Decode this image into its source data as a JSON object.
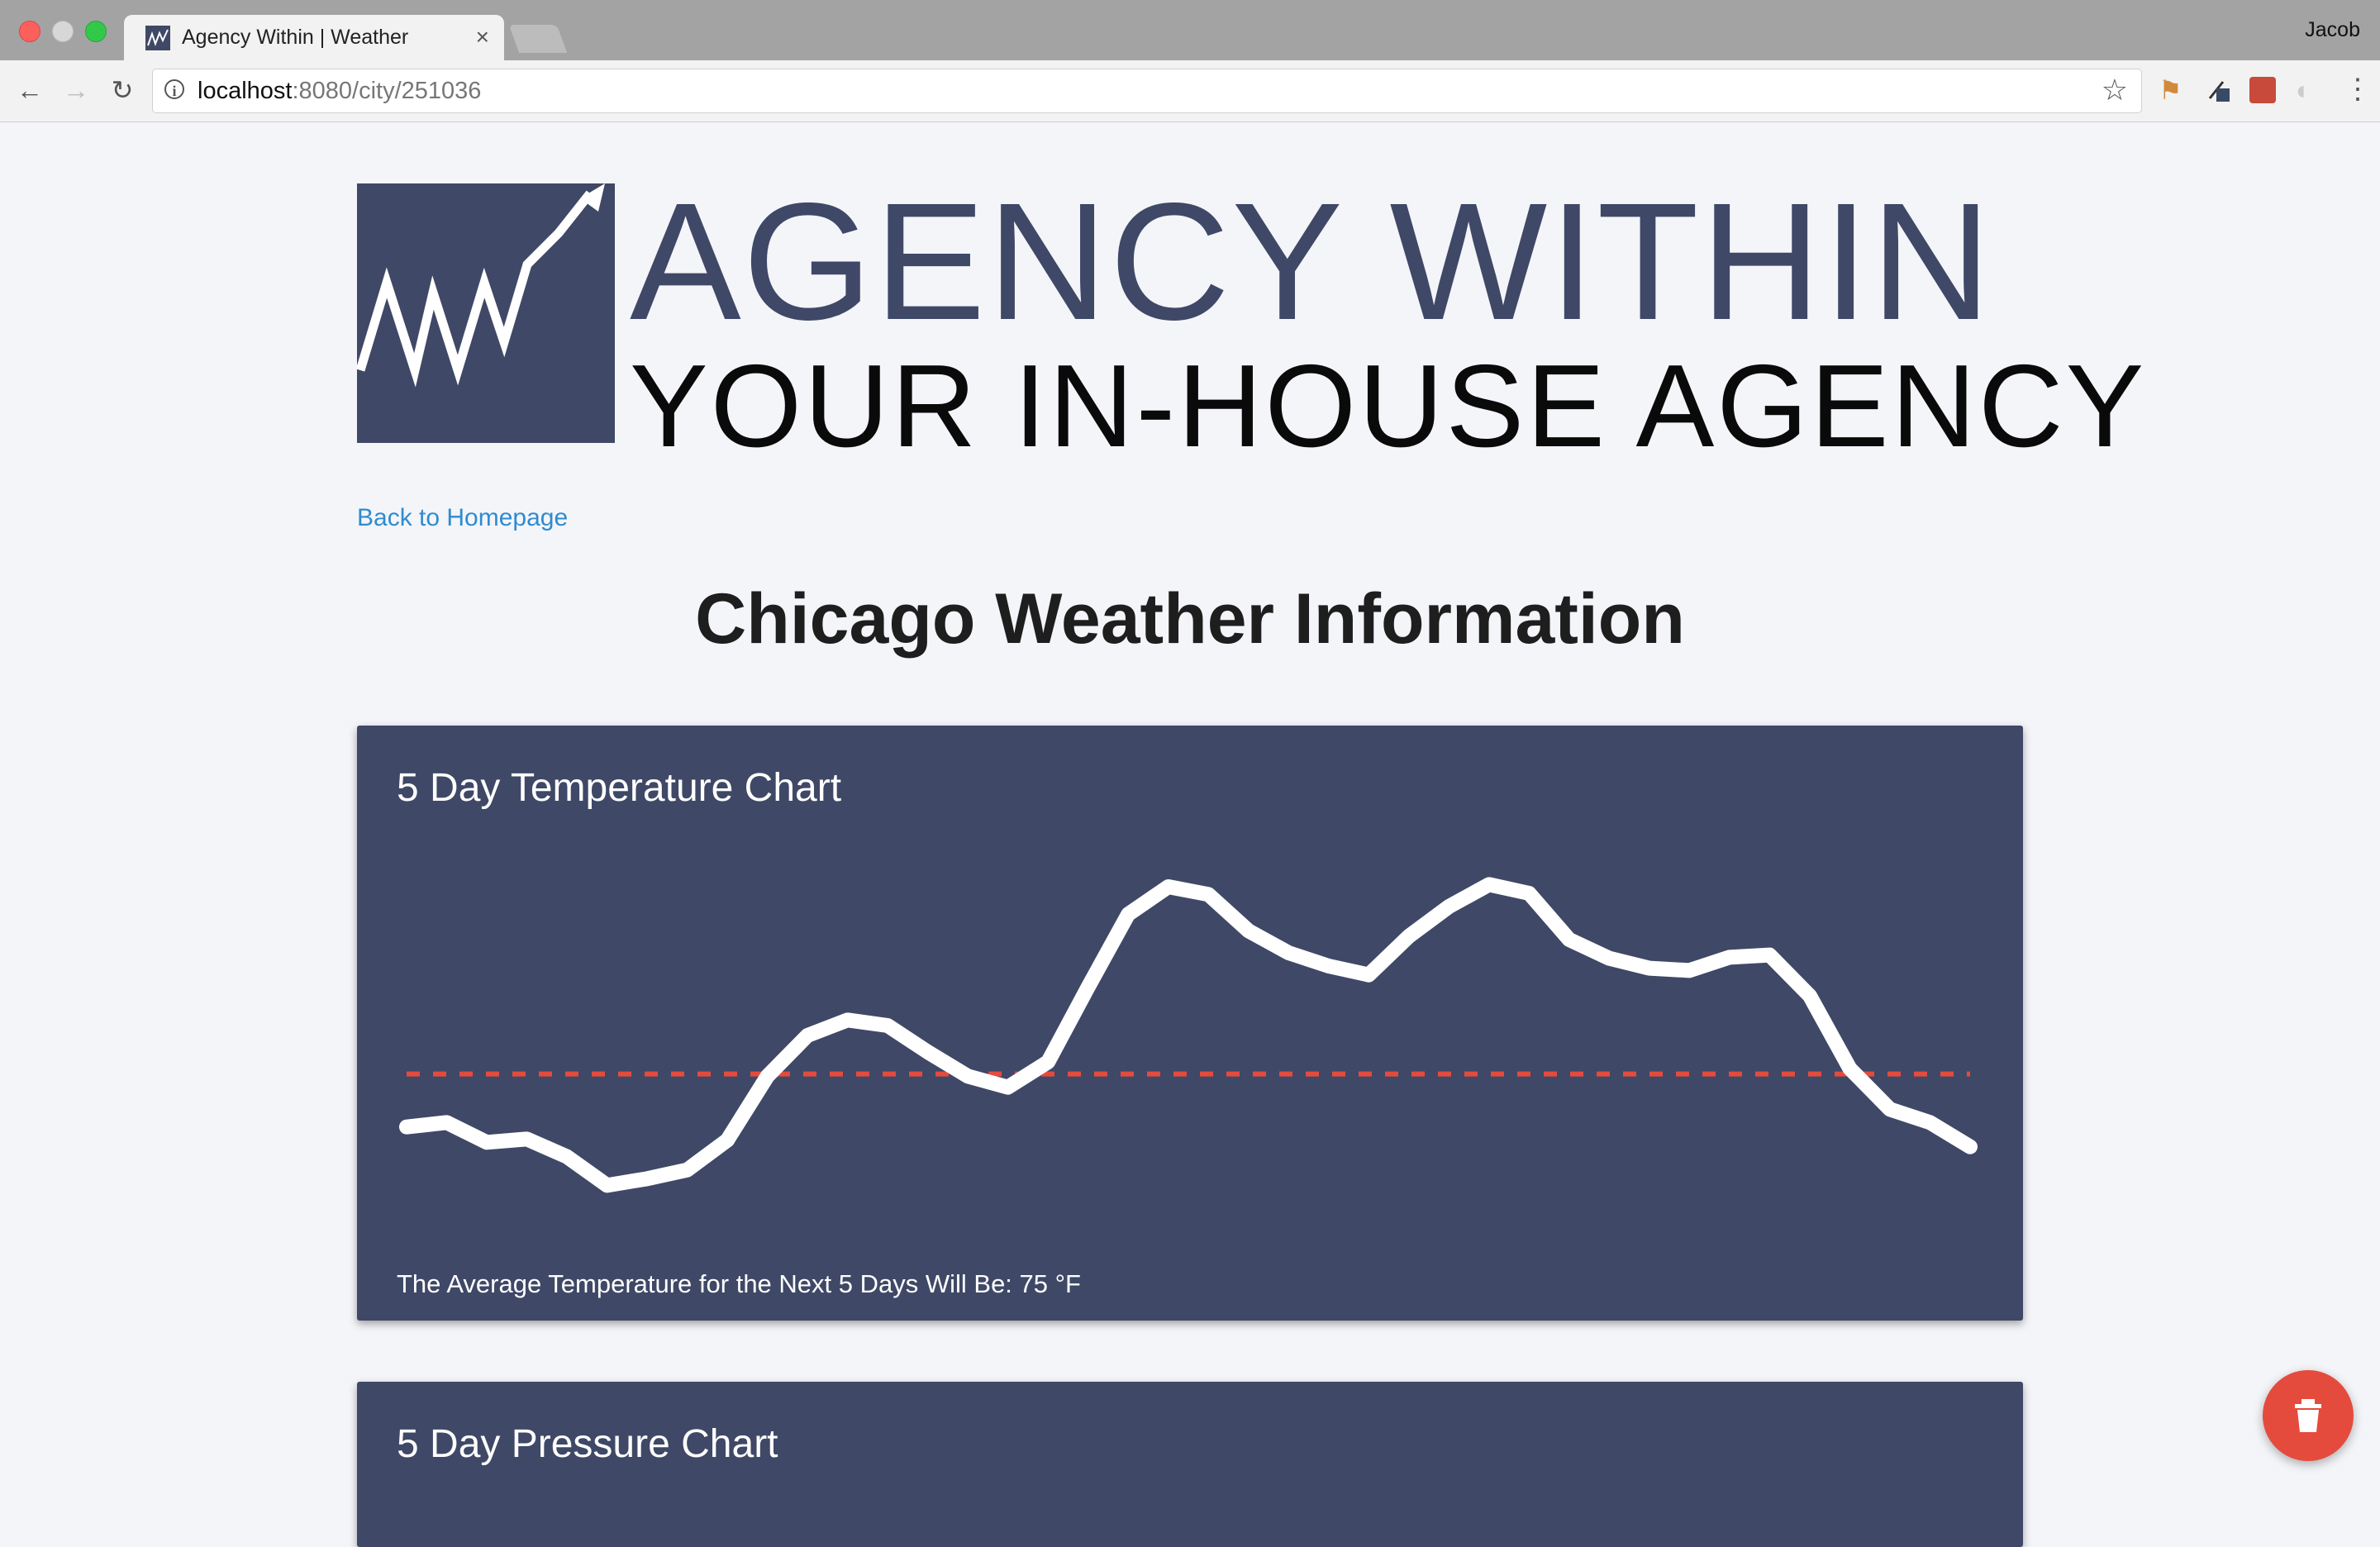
{
  "browser": {
    "tab_title": "Agency Within | Weather",
    "tab_close": "×",
    "profile_name": "Jacob",
    "url_host": "localhost",
    "url_path": ":8080/city/251036"
  },
  "logo": {
    "line1": "AGENCY WITHIN",
    "line2": "YOUR IN-HOUSE AGENCY",
    "brand_color": "#3f4866"
  },
  "nav": {
    "back_link": "Back to Homepage"
  },
  "page": {
    "title": "Chicago Weather Information"
  },
  "temperature_card": {
    "title": "5 Day Temperature Chart",
    "average_text": "The Average Temperature for the Next 5 Days Will Be: 75 °F"
  },
  "pressure_card": {
    "title": "5 Day Pressure Chart"
  },
  "colors": {
    "card_bg": "#3f4866",
    "line": "#ffffff",
    "average_line": "#e54b3c",
    "link": "#2f8bd0",
    "fab": "#e54b3c"
  },
  "chart_data": {
    "type": "line",
    "title": "5 Day Temperature Chart",
    "xlabel": "",
    "ylabel": "",
    "values": [
      70.2,
      70.6,
      68.8,
      69.1,
      67.5,
      64.9,
      65.5,
      66.3,
      69.0,
      74.8,
      78.5,
      79.9,
      79.4,
      77.0,
      74.8,
      73.8,
      76.1,
      82.9,
      89.5,
      92.0,
      91.3,
      88.0,
      86.0,
      84.8,
      84.0,
      87.5,
      90.2,
      92.2,
      91.4,
      87.2,
      85.5,
      84.6,
      84.4,
      85.6,
      85.8,
      82.1,
      75.5,
      71.8,
      70.6,
      68.4
    ],
    "average": 75,
    "average_unit": "°F",
    "average_line_style": "dashed",
    "ylim": [
      62,
      95
    ],
    "grid": false,
    "legend": "none"
  }
}
